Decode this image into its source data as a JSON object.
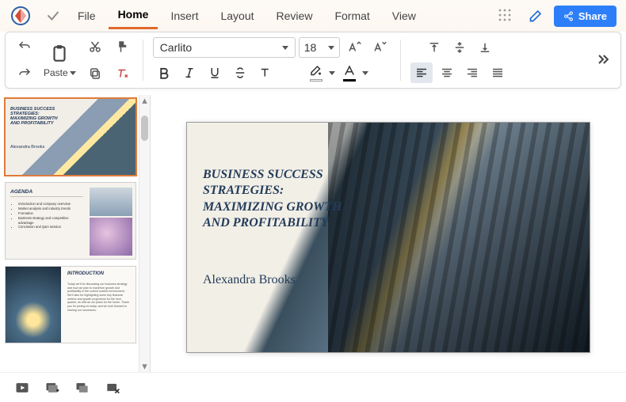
{
  "menu": {
    "items": [
      "File",
      "Home",
      "Insert",
      "Layout",
      "Review",
      "Format",
      "View"
    ],
    "active_index": 1,
    "share_label": "Share"
  },
  "toolbar": {
    "paste_label": "Paste",
    "font_name": "Carlito",
    "font_size": "18"
  },
  "slides": [
    {
      "title": "BUSINESS SUCCESS STRATEGIES: MAXIMIZING GROWTH AND PROFITABILITY",
      "author": "Alexandra Brooks"
    },
    {
      "title": "AGENDA",
      "bullets": [
        "Introduction and company overview",
        "Market analysis and industry trends",
        "Formation",
        "Business strategy and competitive advantage",
        "Conclusion and Q&A session"
      ]
    },
    {
      "title": "INTRODUCTION",
      "body": "Today we'll be discussing our business strategy and how we plan to maximize growth and profitability in the current market environment.\nWe'll also be highlighting some key financial metrics and growth projections for the next quarter, as well as our plans for the future. Thank you for joining us today, and we look forward to sharing our successes."
    }
  ],
  "current_slide_index": 0,
  "colors": {
    "accent": "#e06a2b",
    "primary_text": "#233c5a",
    "share_btn": "#2d7ff9"
  }
}
